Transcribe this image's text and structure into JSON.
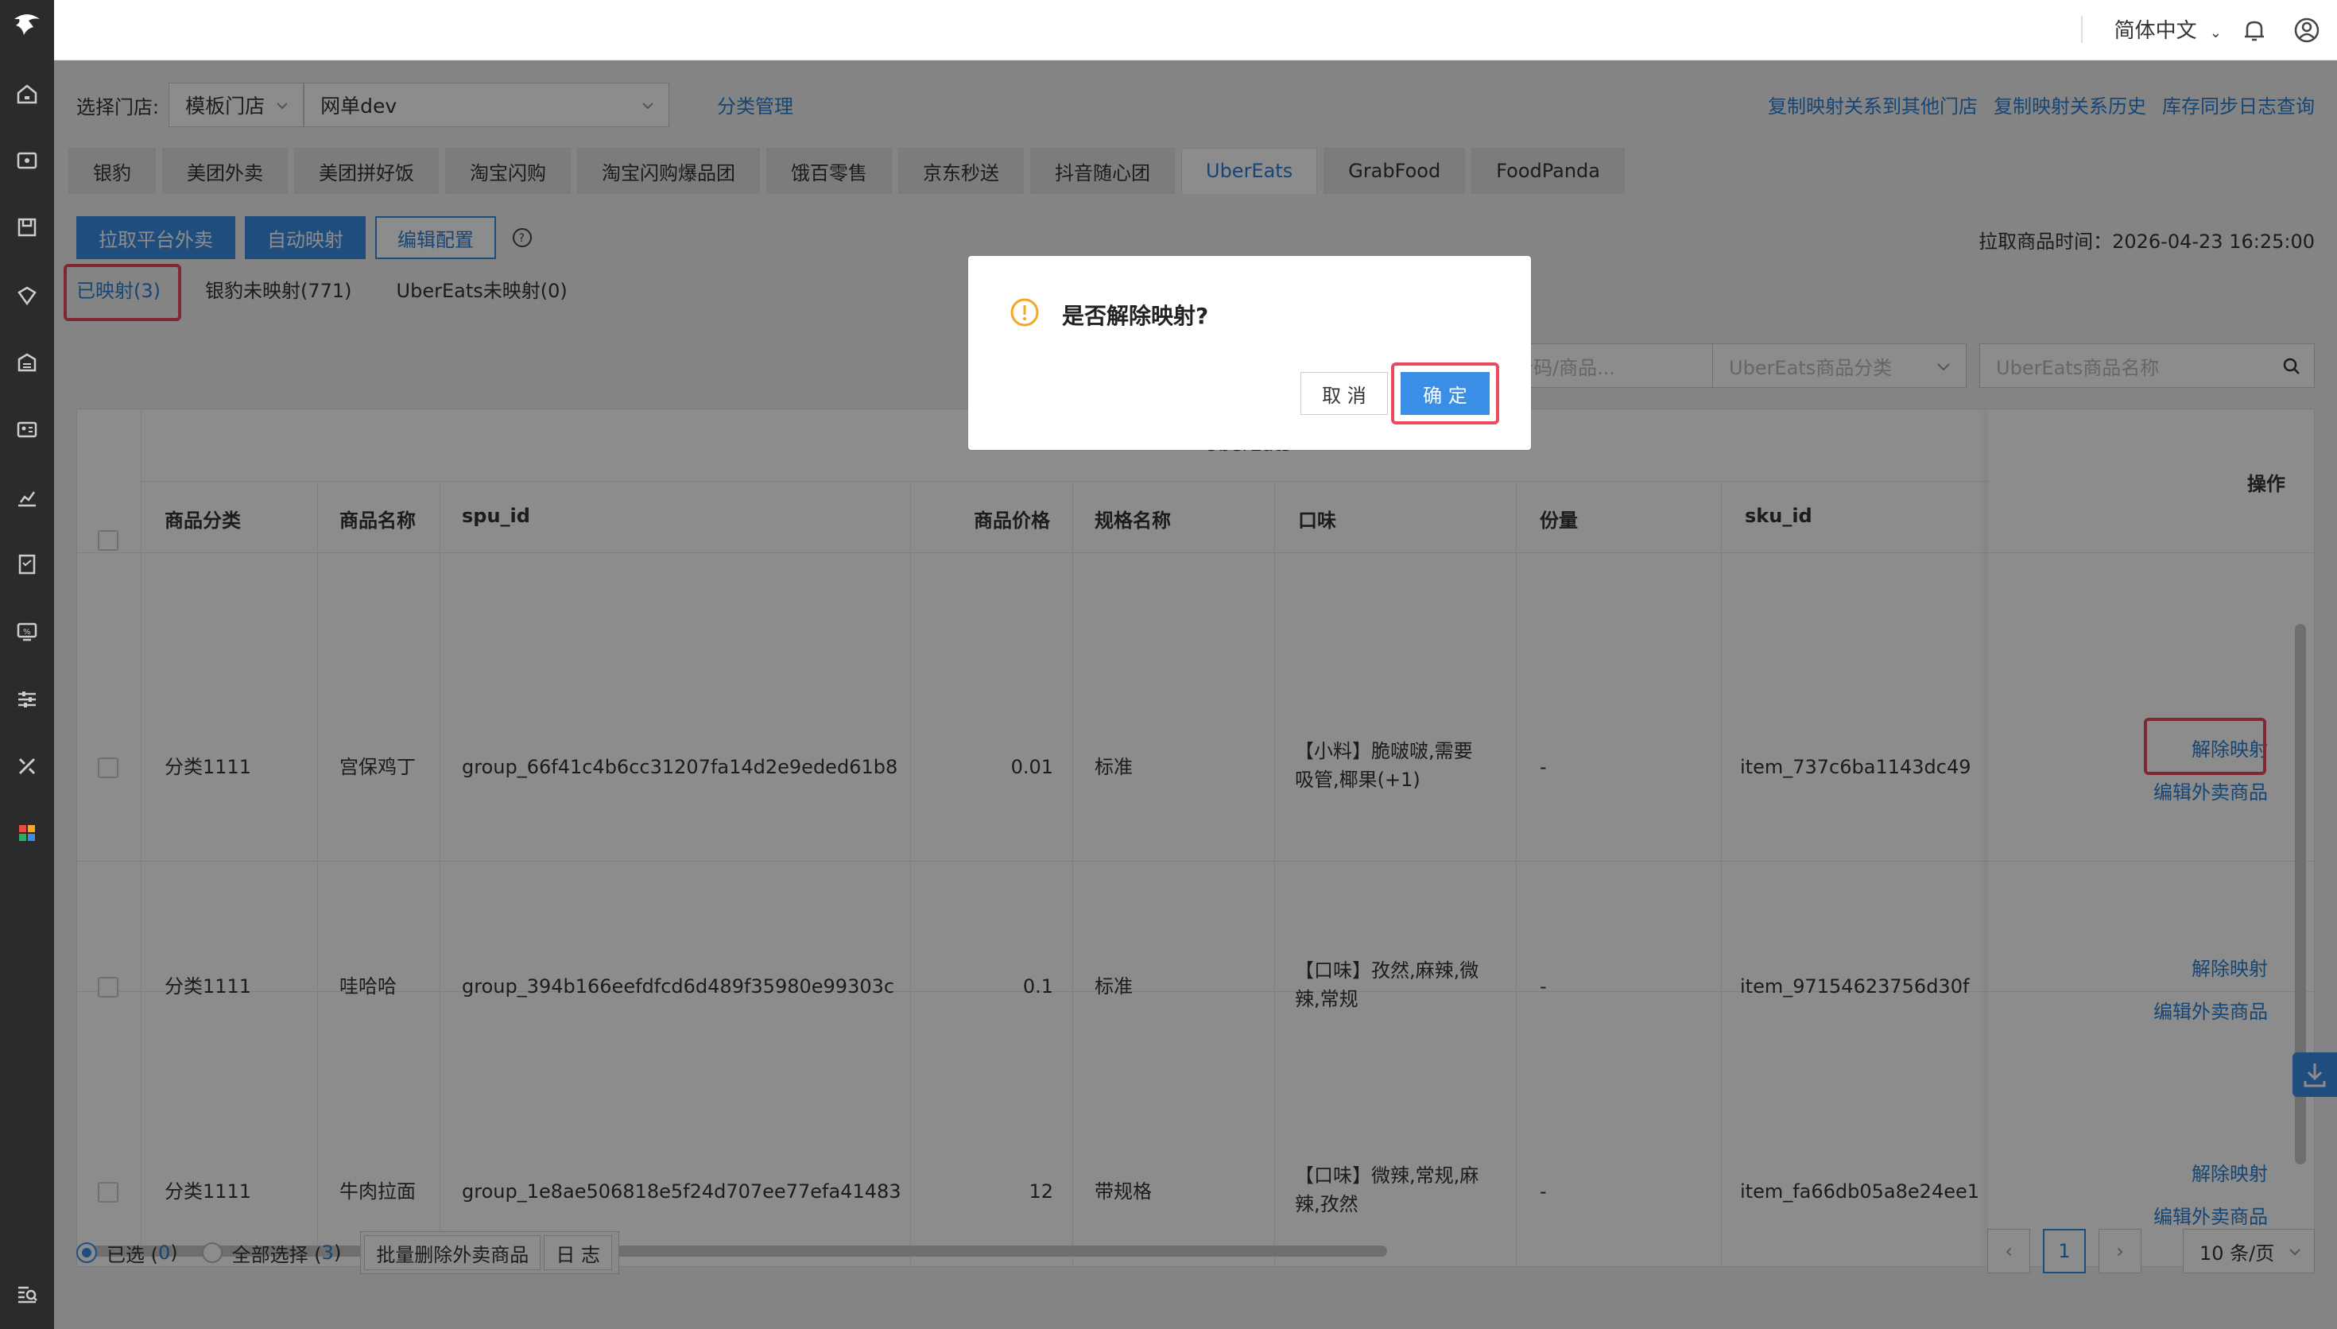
{
  "topbar": {
    "language": "简体中文"
  },
  "store": {
    "label": "选择门店:",
    "type_value": "模板门店",
    "store_value": "网单dev",
    "category_link": "分类管理"
  },
  "top_links": [
    "复制映射关系到其他门店",
    "复制映射关系历史",
    "库存同步日志查询"
  ],
  "platform_tabs": [
    "银豹",
    "美团外卖",
    "美团拼好饭",
    "淘宝闪购",
    "淘宝闪购爆品团",
    "饿百零售",
    "京东秒送",
    "抖音随心团",
    "UberEats",
    "GrabFood",
    "FoodPanda"
  ],
  "actions": {
    "pull": "拉取平台外卖",
    "auto_map": "自动映射",
    "edit_config": "编辑配置",
    "fetch_time": "拉取商品时间：2026-04-23 16:25:00"
  },
  "sub_tabs": [
    "已映射(3)",
    "银豹未映射(771)",
    "UberEats未映射(0)"
  ],
  "filters": {
    "search_placeholder": "称/拼音码/商品...",
    "category_placeholder": "UberEats商品分类",
    "name_placeholder": "UberEats商品名称"
  },
  "table": {
    "group_header": "UberEats",
    "op_header": "操作",
    "headers": [
      "商品分类",
      "商品名称",
      "spu_id",
      "商品价格",
      "规格名称",
      "口味",
      "份量",
      "sku_id"
    ],
    "rows": [
      {
        "category": "分类1111",
        "name": "宫保鸡丁",
        "spu": "group_66f41c4b6cc31207fa14d2e9eded61b8",
        "price": "0.01",
        "spec": "标准",
        "taste1": "【小料】脆啵啵,需要",
        "taste2": "吸管,椰果(+1)",
        "portion": "-",
        "sku": "item_737c6ba1143dc49"
      },
      {
        "category": "分类1111",
        "name": "哇哈哈",
        "spu": "group_394b166eefdfcd6d489f35980e99303c",
        "price": "0.1",
        "spec": "标准",
        "taste1": "【口味】孜然,麻辣,微",
        "taste2": "辣,常规",
        "portion": "-",
        "sku": "item_97154623756d30f"
      },
      {
        "category": "分类1111",
        "name": "牛肉拉面",
        "spu": "group_1e8ae506818e5f24d707ee77efa41483",
        "price": "12",
        "spec": "带规格",
        "taste1": "【口味】微辣,常规,麻",
        "taste2": "辣,孜然",
        "portion": "-",
        "sku": "item_fa66db05a8e24ee1"
      }
    ],
    "op_unmap": "解除映射",
    "op_edit": "编辑外卖商品"
  },
  "bottom": {
    "selected_label": "已选 (",
    "selected_count": "0",
    "all_label": "全部选择 (",
    "all_count": "3",
    "close_paren": " )",
    "batch_delete": "批量删除外卖商品",
    "log": "日 志"
  },
  "pager": {
    "current": "1",
    "size": "10 条/页"
  },
  "dialog": {
    "title": "是否解除映射?",
    "cancel": "取 消",
    "ok": "确 定"
  },
  "colors": {
    "accent": "#3a8ee6",
    "highlight": "#e84a5f",
    "warning": "#f5a623"
  }
}
